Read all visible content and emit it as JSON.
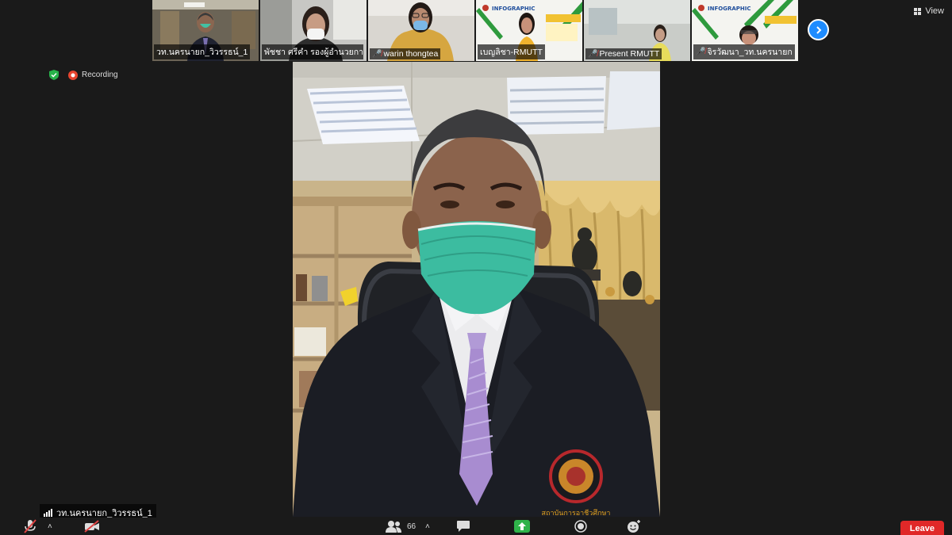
{
  "gallery": {
    "tiles": [
      {
        "name": "วท.นครนายก_วิวรรธน์_1",
        "muted": false
      },
      {
        "name": "พัชชา ศรีคำ รองผู้อำนวยการร...",
        "muted": false
      },
      {
        "name": "warin thongtea",
        "muted": true
      },
      {
        "name": "เบญลิชา-RMUTT",
        "muted": false
      },
      {
        "name": "Present RMUTT",
        "muted": true
      },
      {
        "name": "จิรวัฒนา_วท.นครนายก",
        "muted": true
      }
    ],
    "infographic_text": "INFOGRAPHIC",
    "next_icon": "chevron-right-icon"
  },
  "view": {
    "label": "View"
  },
  "status": {
    "recording_label": "Recording",
    "security_icon": "shield-check-icon"
  },
  "main_video": {
    "speaker_label": "วท.นครนายก_วิวรรธน์_1",
    "badge_text": "สถาบันการอาชีวศึกษา"
  },
  "toolbar": {
    "participants_count": "66",
    "leave_label": "Leave"
  },
  "colors": {
    "accent": "#1e8cff",
    "active_tile": "#8fbf3a",
    "leave": "#e02828",
    "mask": "#3cbca0"
  }
}
